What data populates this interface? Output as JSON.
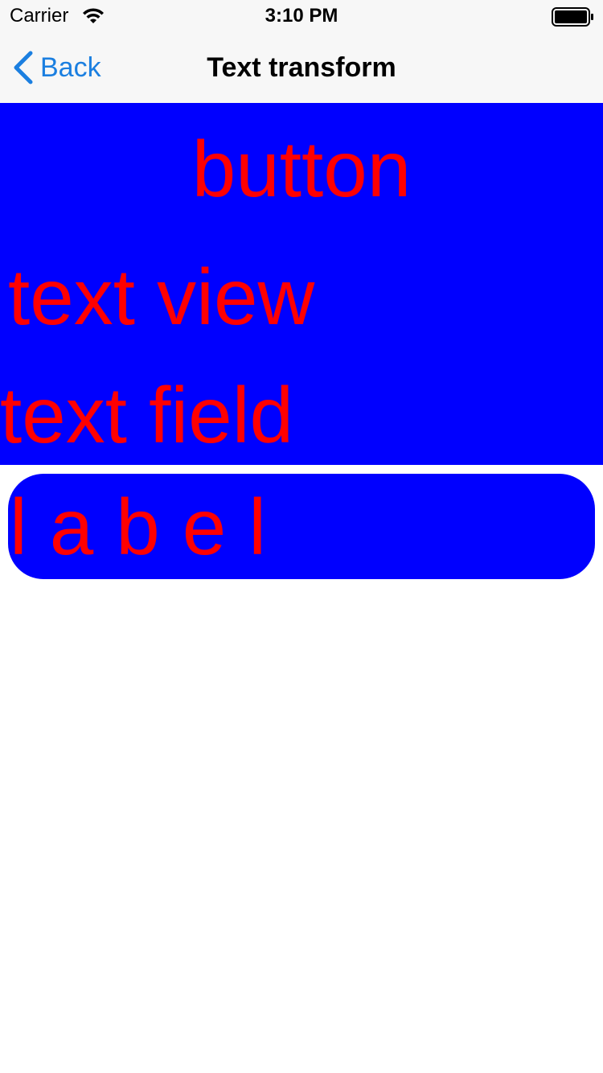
{
  "status_bar": {
    "carrier": "Carrier",
    "time": "3:10 PM",
    "icons": [
      "wifi-icon",
      "battery-icon"
    ]
  },
  "nav": {
    "back_label": "Back",
    "title": "Text transform",
    "back_icon": "chevron-left-icon",
    "accent_color": "#1b7fe0"
  },
  "content": {
    "button_label": "button",
    "text_view_text": "text view",
    "text_field_value": "text field",
    "label_text": "label"
  },
  "colors": {
    "panel_background": "#0000ff",
    "text_color": "#ff0000"
  }
}
